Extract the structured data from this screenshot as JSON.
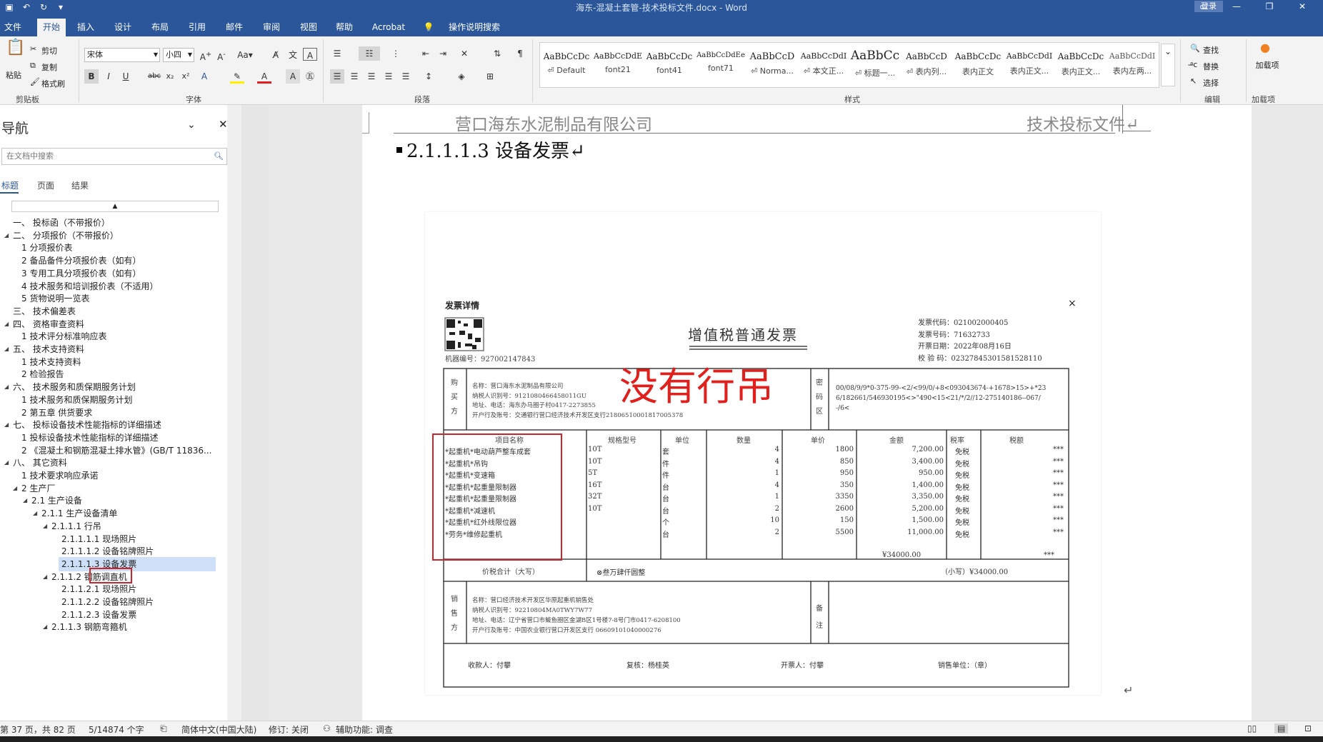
{
  "titlebar": {
    "document_title": "海东-混凝土套管-技术投标文件.docx  -  Word",
    "signin": "登录",
    "icons": [
      "save-icon",
      "undo-icon",
      "redo-icon",
      "customize-icon"
    ]
  },
  "ribbon_tabs": [
    "文件",
    "开始",
    "插入",
    "设计",
    "布局",
    "引用",
    "邮件",
    "审阅",
    "视图",
    "帮助",
    "Acrobat",
    "操作说明搜索"
  ],
  "ribbon": {
    "clipboard": {
      "paste": "粘贴",
      "cut": "剪切",
      "copy": "复制",
      "format_painter": "格式刷",
      "label": "剪贴板"
    },
    "font": {
      "family": "宋体",
      "size": "小四",
      "label": "字体"
    },
    "paragraph": {
      "label": "段落"
    },
    "styles": {
      "label": "样式",
      "items": [
        {
          "preview": "AaBbCcDc",
          "name": "⏎ Default"
        },
        {
          "preview": "AaBbCcDdE",
          "name": "font21"
        },
        {
          "preview": "AaBbCcDc",
          "name": "font41"
        },
        {
          "preview": "AaBbCcDdEe",
          "name": "font71"
        },
        {
          "preview": "AaBbCcD",
          "name": "⏎ Norma..."
        },
        {
          "preview": "AaBbCcDdI",
          "name": "⏎ 本文正..."
        },
        {
          "preview": "AaBbCc",
          "name": "⏎ 标题一..."
        },
        {
          "preview": "AaBbCcD",
          "name": "⏎ 表内列..."
        },
        {
          "preview": "AaBbCcDc",
          "name": "表内正文"
        },
        {
          "preview": "AaBbCcDdI",
          "name": "表内正文..."
        },
        {
          "preview": "AaBbCcDc",
          "name": "表内正文..."
        },
        {
          "preview": "AaBbCcDdI",
          "name": "表内左两..."
        }
      ]
    },
    "editing": {
      "find": "查找",
      "replace": "替换",
      "select": "选择",
      "label": "编辑"
    },
    "addins": {
      "load": "加载项",
      "label": "加载项"
    }
  },
  "nav": {
    "title": "导航",
    "search_placeholder": "在文档中搜索",
    "tabs": [
      "标题",
      "页面",
      "结果"
    ],
    "items": [
      {
        "text": "一、 投标函（不带报价）",
        "level": 0,
        "tw": ""
      },
      {
        "text": "二、 分项报价（不带报价）",
        "level": 0,
        "tw": "◢"
      },
      {
        "text": "1 分项报价表",
        "level": 1,
        "tw": ""
      },
      {
        "text": "2 备品备件分项报价表（如有）",
        "level": 1,
        "tw": ""
      },
      {
        "text": "3 专用工具分项报价表（如有）",
        "level": 1,
        "tw": ""
      },
      {
        "text": "4 技术服务和培训报价表（不适用）",
        "level": 1,
        "tw": ""
      },
      {
        "text": "5 货物说明一览表",
        "level": 1,
        "tw": ""
      },
      {
        "text": "三、 技术偏差表",
        "level": 0,
        "tw": ""
      },
      {
        "text": "四、 资格审查资料",
        "level": 0,
        "tw": "◢"
      },
      {
        "text": "1 技术评分标准响应表",
        "level": 1,
        "tw": ""
      },
      {
        "text": "五、 技术支持资料",
        "level": 0,
        "tw": "◢"
      },
      {
        "text": "1 技术支持资料",
        "level": 1,
        "tw": ""
      },
      {
        "text": "2 检验报告",
        "level": 1,
        "tw": ""
      },
      {
        "text": "六、 技术服务和质保期服务计划",
        "level": 0,
        "tw": "◢"
      },
      {
        "text": "1 技术服务和质保期服务计划",
        "level": 1,
        "tw": ""
      },
      {
        "text": "2 第五章  供货要求",
        "level": 1,
        "tw": ""
      },
      {
        "text": "七、 投标设备技术性能指标的详细描述",
        "level": 0,
        "tw": "◢"
      },
      {
        "text": "1 投标设备技术性能指标的详细描述",
        "level": 1,
        "tw": ""
      },
      {
        "text": "2 《混凝土和钢筋混凝土排水管》(GB/T 11836...",
        "level": 1,
        "tw": ""
      },
      {
        "text": "八、 其它资料",
        "level": 0,
        "tw": "◢"
      },
      {
        "text": "1 技术要求响应承诺",
        "level": 1,
        "tw": ""
      },
      {
        "text": "2 生产厂",
        "level": 1,
        "tw": "◢"
      },
      {
        "text": "2.1 生产设备",
        "level": 2,
        "tw": "◢"
      },
      {
        "text": "2.1.1 生产设备清单",
        "level": 3,
        "tw": "◢"
      },
      {
        "text": "2.1.1.1 行吊",
        "level": 4,
        "tw": "◢"
      },
      {
        "text": "2.1.1.1.1 现场照片",
        "level": 5,
        "tw": ""
      },
      {
        "text": "2.1.1.1.2 设备铭牌照片",
        "level": 5,
        "tw": ""
      },
      {
        "text": "2.1.1.1.3 设备发票",
        "level": 5,
        "tw": "",
        "selected": true
      },
      {
        "text": "2.1.1.2 钢筋调直机",
        "level": 4,
        "tw": "◢"
      },
      {
        "text": "2.1.1.2.1 现场照片",
        "level": 5,
        "tw": ""
      },
      {
        "text": "2.1.1.2.2 设备铭牌照片",
        "level": 5,
        "tw": ""
      },
      {
        "text": "2.1.1.2.3 设备发票",
        "level": 5,
        "tw": ""
      },
      {
        "text": "2.1.1.3 钢筋弯箍机",
        "level": 4,
        "tw": "◢"
      }
    ]
  },
  "document": {
    "header_left": "营口海东水泥制品有限公司",
    "header_right": "技术投标文件↵",
    "heading": "2.1.1.1.3 设备发票↵",
    "return_mark": "↵"
  },
  "invoice": {
    "dialog_title": "发票详情",
    "close": "×",
    "title": "增值税普通发票",
    "code_label": "发票代码：",
    "code": "021002000405",
    "number_label": "发票号码：",
    "number": "71632733",
    "date_label": "开票日期：",
    "date": "2022年08月16日",
    "check_label": "校 验 码：",
    "check": "02327845301581528110",
    "machine_label": "机器编号：",
    "machine": "927002147843",
    "annotation": "没有行吊",
    "buyer_side": "购买方",
    "buyer_lines": [
      "名称：营口海东水泥制品有限公司",
      "纳税人识别号：9121080466458011GU",
      "地址、电话：海东办马圈子村0417-2273855",
      "开户行及账号：交通银行营口经济技术开发区支行21806510001817005378"
    ],
    "cipher_label": "密码区",
    "cipher_lines": [
      "00/08/9/9*0-375-99-<2/<99/0/+8<093043674-+1678>15>+*23",
      "6/182661/546930195<>\"490<15<21/*/2//12-275140186--067/",
      "-/6<"
    ],
    "table_headers": [
      "项目名称",
      "规格型号",
      "单位",
      "数量",
      "单价",
      "金额",
      "税率",
      "税额"
    ],
    "rows": [
      {
        "name": "*起重机*电动葫芦整车成套",
        "spec": "10T",
        "unit": "套",
        "qty": "4",
        "price": "1800",
        "amount": "7,200.00",
        "rate": "免税",
        "tax": "***"
      },
      {
        "name": "*起重机*吊钩",
        "spec": "10T",
        "unit": "件",
        "qty": "4",
        "price": "850",
        "amount": "3,400.00",
        "rate": "免税",
        "tax": "***"
      },
      {
        "name": "*起重机*变速箱",
        "spec": "5T",
        "unit": "件",
        "qty": "1",
        "price": "950",
        "amount": "950.00",
        "rate": "免税",
        "tax": "***"
      },
      {
        "name": "*起重机*起重量限制器",
        "spec": "16T",
        "unit": "台",
        "qty": "4",
        "price": "350",
        "amount": "1,400.00",
        "rate": "免税",
        "tax": "***"
      },
      {
        "name": "*起重机*起重量限制器",
        "spec": "32T",
        "unit": "台",
        "qty": "1",
        "price": "3350",
        "amount": "3,350.00",
        "rate": "免税",
        "tax": "***"
      },
      {
        "name": "*起重机*减速机",
        "spec": "10T",
        "unit": "台",
        "qty": "2",
        "price": "2600",
        "amount": "5,200.00",
        "rate": "免税",
        "tax": "***"
      },
      {
        "name": "*起重机*红外线限位器",
        "spec": "",
        "unit": "个",
        "qty": "10",
        "price": "150",
        "amount": "1,500.00",
        "rate": "免税",
        "tax": "***"
      },
      {
        "name": "*劳务*维修起重机",
        "spec": "",
        "unit": "台",
        "qty": "2",
        "price": "5500",
        "amount": "11,000.00",
        "rate": "免税",
        "tax": "***"
      }
    ],
    "subtotal_amount": "¥34000.00",
    "subtotal_tax": "***",
    "total_label": "价税合计（大写）",
    "total_words": "⊗叁万肆仟圆整",
    "total_small": "（小写）¥34000.00",
    "seller_side": "销售方",
    "seller_lines": [
      "名称：营口经济技术开发区华原起重机销售处",
      "纳税人识别号：92210804MA0TWY7W77",
      "地址、电话：辽宁省营口市鲅鱼圈区金湖B区1号楼7-8号门市0417-6208100",
      "开户行及账号：中国农业银行营口开发区支行 06609101040000276"
    ],
    "remark_label": "备注",
    "payee": "收款人：付攀",
    "reviewer": "复核：杨桂英",
    "drawer": "开票人：付攀",
    "seller_seal": "销售单位：（章）"
  },
  "status": {
    "page": "第 37 页，共 82 页",
    "words": "5/14874 个字",
    "language": "简体中文(中国大陆)",
    "track": "修订: 关闭",
    "accessibility": "辅助功能: 调查"
  },
  "colors": {
    "brand": "#2b579a",
    "annotation": "#e0201c",
    "highlight_box": "#d0242b"
  }
}
